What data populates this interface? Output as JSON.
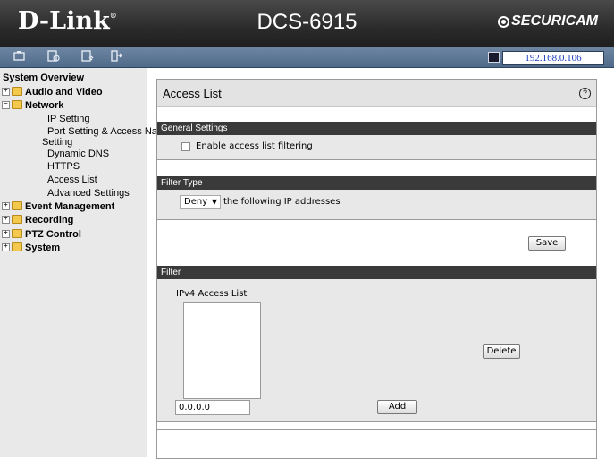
{
  "header": {
    "logo": "D-Link",
    "model": "DCS-6915",
    "brand": "SECURICAM"
  },
  "toolbar": {
    "icons": [
      "live-view-icon",
      "playback-icon",
      "setup-icon",
      "logout-icon"
    ],
    "ip_address": "192.168.0.106"
  },
  "sidebar": {
    "overview": "System Overview",
    "audio_video": "Audio and Video",
    "network": "Network",
    "ip_setting": "IP Setting",
    "port_setting_1": "Port Setting & Access Nan",
    "port_setting_2": "Setting",
    "dynamic_dns": "Dynamic DNS",
    "https": "HTTPS",
    "access_list": "Access List",
    "advanced_settings": "Advanced Settings",
    "event_management": "Event Management",
    "recording": "Recording",
    "ptz_control": "PTZ Control",
    "system": "System"
  },
  "main": {
    "title": "Access List",
    "help": "?",
    "general_settings": {
      "header": "General Settings",
      "enable_label": "Enable access list filtering",
      "enabled": false
    },
    "filter_type": {
      "header": "Filter Type",
      "mode": "Deny",
      "suffix": "the following IP addresses",
      "save_label": "Save"
    },
    "filter": {
      "header": "Filter",
      "list_label": "IPv4 Access List",
      "entries": [],
      "delete_label": "Delete",
      "input_value": "0.0.0.0",
      "add_label": "Add"
    }
  }
}
